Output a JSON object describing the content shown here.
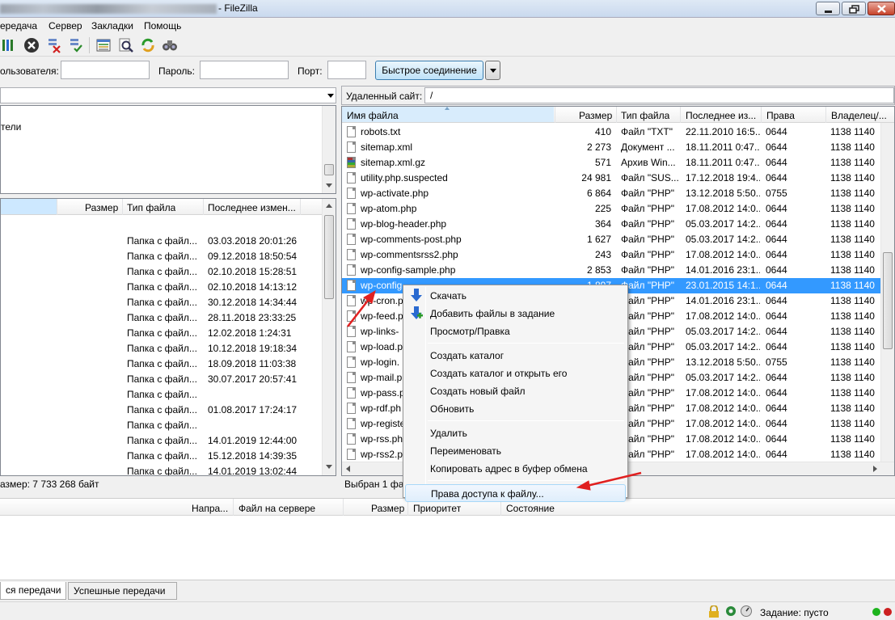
{
  "window": {
    "title_suffix": "- FileZilla",
    "controls": [
      "minimize",
      "maximize",
      "close"
    ]
  },
  "menu": [
    "ередача",
    "Сервер",
    "Закладки",
    "Помощь"
  ],
  "toolbar": {
    "icons": [
      "process-queue-icon",
      "cancel-icon",
      "disconnect-icon",
      "reconnect-icon",
      "dir-listing-icon",
      "filter-icon",
      "refresh-icon",
      "find-icon"
    ]
  },
  "quickconnect": {
    "user_label": "ользователя:",
    "password_label": "Пароль:",
    "port_label": "Порт:",
    "connect_button": "Быстрое соединение"
  },
  "local": {
    "tree_fragment": "тели",
    "columns": [
      "Размер",
      "Тип файла",
      "Последнее измен..."
    ],
    "rows": [
      {
        "type": "",
        "date": ""
      },
      {
        "type": "Папка с файл...",
        "date": "03.03.2018 20:01:26"
      },
      {
        "type": "Папка с файл...",
        "date": "09.12.2018 18:50:54"
      },
      {
        "type": "Папка с файл...",
        "date": "02.10.2018 15:28:51"
      },
      {
        "type": "Папка с файл...",
        "date": "02.10.2018 14:13:12"
      },
      {
        "type": "Папка с файл...",
        "date": "30.12.2018 14:34:44"
      },
      {
        "type": "Папка с файл...",
        "date": "28.11.2018 23:33:25"
      },
      {
        "type": "Папка с файл...",
        "date": "12.02.2018 1:24:31"
      },
      {
        "type": "Папка с файл...",
        "date": "10.12.2018 19:18:34"
      },
      {
        "type": "Папка с файл...",
        "date": "18.09.2018 11:03:38"
      },
      {
        "type": "Папка с файл...",
        "date": "30.07.2017 20:57:41"
      },
      {
        "type": "Папка с файл...",
        "date": ""
      },
      {
        "type": "Папка с файл...",
        "date": "01.08.2017 17:24:17"
      },
      {
        "type": "Папка с файл...",
        "date": ""
      },
      {
        "type": "Папка с файл...",
        "date": "14.01.2019 12:44:00"
      },
      {
        "type": "Папка с файл...",
        "date": "15.12.2018 14:39:35"
      },
      {
        "type": "Папка с файл...",
        "date": "14.01.2019 13:02:44"
      }
    ],
    "status": "азмер: 7 733 268 байт"
  },
  "remote": {
    "site_label": "Удаленный сайт:",
    "path": "/",
    "columns": [
      "Имя файла",
      "Размер",
      "Тип файла",
      "Последнее из...",
      "Права",
      "Владелец/..."
    ],
    "files": [
      {
        "name": "robots.txt",
        "size": "410",
        "type": "Файл \"TXT\"",
        "date": "22.11.2010 16:5...",
        "perm": "0644",
        "owner": "1138 1140"
      },
      {
        "name": "sitemap.xml",
        "size": "2 273",
        "type": "Документ ...",
        "date": "18.11.2011 0:47...",
        "perm": "0644",
        "owner": "1138 1140"
      },
      {
        "name": "sitemap.xml.gz",
        "size": "571",
        "type": "Архив Win...",
        "date": "18.11.2011 0:47...",
        "perm": "0644",
        "owner": "1138 1140"
      },
      {
        "name": "utility.php.suspected",
        "size": "24 981",
        "type": "Файл \"SUS...",
        "date": "17.12.2018 19:4...",
        "perm": "0644",
        "owner": "1138 1140"
      },
      {
        "name": "wp-activate.php",
        "size": "6 864",
        "type": "Файл \"PHP\"",
        "date": "13.12.2018 5:50...",
        "perm": "0755",
        "owner": "1138 1140"
      },
      {
        "name": "wp-atom.php",
        "size": "225",
        "type": "Файл \"PHP\"",
        "date": "17.08.2012 14:0...",
        "perm": "0644",
        "owner": "1138 1140"
      },
      {
        "name": "wp-blog-header.php",
        "size": "364",
        "type": "Файл \"PHP\"",
        "date": "05.03.2017 14:2...",
        "perm": "0644",
        "owner": "1138 1140"
      },
      {
        "name": "wp-comments-post.php",
        "size": "1 627",
        "type": "Файл \"PHP\"",
        "date": "05.03.2017 14:2...",
        "perm": "0644",
        "owner": "1138 1140"
      },
      {
        "name": "wp-commentsrss2.php",
        "size": "243",
        "type": "Файл \"PHP\"",
        "date": "17.08.2012 14:0...",
        "perm": "0644",
        "owner": "1138 1140"
      },
      {
        "name": "wp-config-sample.php",
        "size": "2 853",
        "type": "Файл \"PHP\"",
        "date": "14.01.2016 23:1...",
        "perm": "0644",
        "owner": "1138 1140"
      },
      {
        "name": "wp-config",
        "size": "1 897",
        "type": "Файл \"PHP\"",
        "date": "23.01.2015 14:1...",
        "perm": "0644",
        "owner": "1138 1140",
        "selected": true
      },
      {
        "name": "wp-cron.p",
        "size": "",
        "type": "Файл \"PHP\"",
        "date": "14.01.2016 23:1...",
        "perm": "0644",
        "owner": "1138 1140"
      },
      {
        "name": "wp-feed.p",
        "size": "",
        "type": "Файл \"PHP\"",
        "date": "17.08.2012 14:0...",
        "perm": "0644",
        "owner": "1138 1140"
      },
      {
        "name": "wp-links-",
        "size": "",
        "type": "Файл \"PHP\"",
        "date": "05.03.2017 14:2...",
        "perm": "0644",
        "owner": "1138 1140"
      },
      {
        "name": "wp-load.p",
        "size": "",
        "type": "Файл \"PHP\"",
        "date": "05.03.2017 14:2...",
        "perm": "0644",
        "owner": "1138 1140"
      },
      {
        "name": "wp-login.",
        "size": "",
        "type": "Файл \"PHP\"",
        "date": "13.12.2018 5:50...",
        "perm": "0755",
        "owner": "1138 1140"
      },
      {
        "name": "wp-mail.p",
        "size": "",
        "type": "Файл \"PHP\"",
        "date": "05.03.2017 14:2...",
        "perm": "0644",
        "owner": "1138 1140"
      },
      {
        "name": "wp-pass.p",
        "size": "",
        "type": "Файл \"PHP\"",
        "date": "17.08.2012 14:0...",
        "perm": "0644",
        "owner": "1138 1140"
      },
      {
        "name": "wp-rdf.ph",
        "size": "",
        "type": "Файл \"PHP\"",
        "date": "17.08.2012 14:0...",
        "perm": "0644",
        "owner": "1138 1140"
      },
      {
        "name": "wp-registe",
        "size": "",
        "type": "Файл \"PHP\"",
        "date": "17.08.2012 14:0...",
        "perm": "0644",
        "owner": "1138 1140"
      },
      {
        "name": "wp-rss.ph",
        "size": "",
        "type": "Файл \"PHP\"",
        "date": "17.08.2012 14:0...",
        "perm": "0644",
        "owner": "1138 1140"
      },
      {
        "name": "wp-rss2.p",
        "size": "",
        "type": "Файл \"PHP\"",
        "date": "17.08.2012 14:0...",
        "perm": "0644",
        "owner": "1138 1140"
      }
    ],
    "status": "Выбран 1 фай"
  },
  "context_menu": {
    "items": [
      {
        "label": "Скачать",
        "icon": "download-icon"
      },
      {
        "label": "Добавить файлы в задание",
        "icon": "add-to-queue-icon"
      },
      {
        "label": "Просмотр/Правка"
      },
      {
        "sep": true
      },
      {
        "label": "Создать каталог"
      },
      {
        "label": "Создать каталог и открыть его"
      },
      {
        "label": "Создать новый файл"
      },
      {
        "label": "Обновить"
      },
      {
        "sep": true
      },
      {
        "label": "Удалить"
      },
      {
        "label": "Переименовать"
      },
      {
        "label": "Копировать адрес в буфер обмена"
      },
      {
        "sep": true
      },
      {
        "label": "Права доступа к файлу...",
        "hover": true
      }
    ]
  },
  "queue": {
    "columns": [
      "Напра...",
      "Файл на сервере",
      "Размер",
      "Приоритет",
      "Состояние"
    ],
    "tabs": [
      "ся передачи",
      "Успешные передачи"
    ]
  },
  "statusbar": {
    "queue_label": "Задание: пусто",
    "icons": [
      "lock-icon",
      "gear-icon",
      "speedlimit-icon"
    ],
    "indicator_colors": [
      "#1db31d",
      "#cc2020"
    ]
  },
  "annotation": {
    "arrow_color": "#e02020"
  }
}
